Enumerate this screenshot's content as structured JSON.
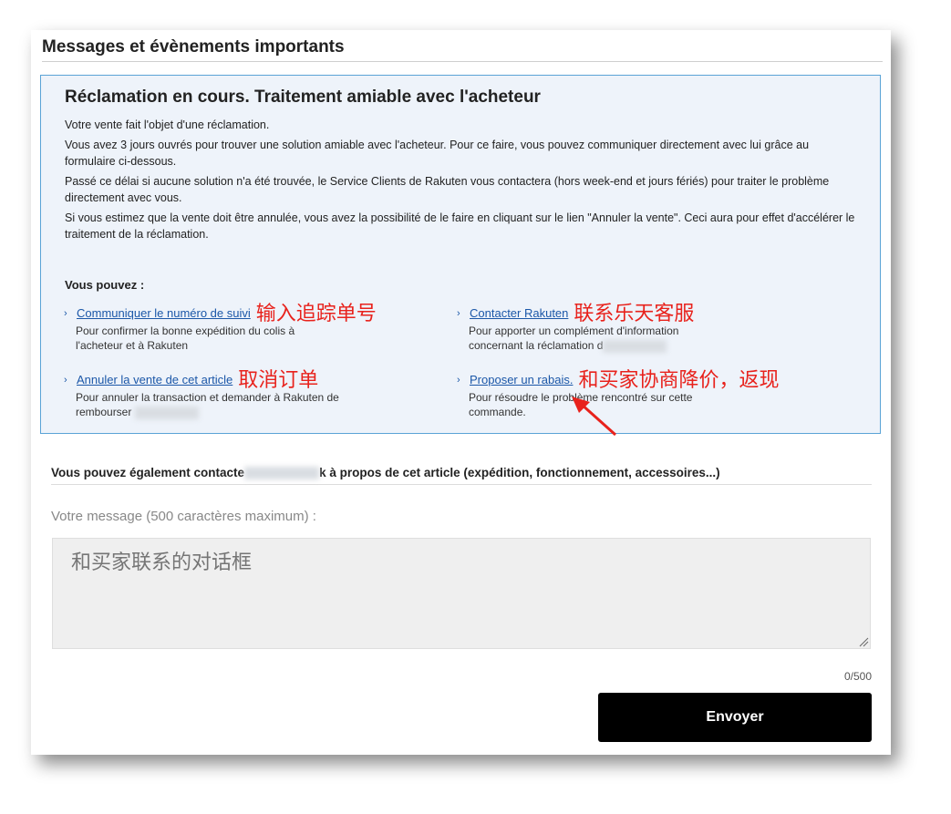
{
  "header": {
    "title": "Messages et évènements importants"
  },
  "claim": {
    "title": "Réclamation en cours. Traitement amiable avec l'acheteur",
    "paragraphs": [
      "Votre vente fait l'objet d'une réclamation.",
      "Vous avez 3 jours ouvrés pour trouver une solution amiable avec l'acheteur. Pour ce faire, vous pouvez communiquer directement avec lui grâce au formulaire ci-dessous.",
      "Passé ce délai si aucune solution n'a été trouvée, le Service Clients de Rakuten vous contactera (hors week-end et jours fériés) pour traiter le problème directement avec vous.",
      "Si vous estimez que la vente doit être annulée, vous avez la possibilité de le faire en cliquant sur le lien \"Annuler la vente\". Ceci aura pour effet d'accélérer le traitement de la réclamation."
    ],
    "vous_pouvez": "Vous pouvez :",
    "actions": {
      "tracking": {
        "link": "Communiquer le numéro de suivi",
        "annotation": "输入追踪单号",
        "desc1": "Pour confirmer la bonne expédition du colis à",
        "desc2": "l'acheteur et à Rakuten"
      },
      "contact": {
        "link": "Contacter Rakuten",
        "annotation": "联系乐天客服",
        "desc1": "Pour apporter un complément d'information",
        "desc2": "concernant la réclamation d"
      },
      "cancel": {
        "link": "Annuler la vente de cet article",
        "annotation": "取消订单",
        "desc1": "Pour annuler la transaction et demander à Rakuten de",
        "desc2": "rembourser"
      },
      "discount": {
        "link": "Proposer un rabais.",
        "annotation": "和买家协商降价，返现",
        "desc1": "Pour résoudre le problème rencontré sur cette",
        "desc2": "commande."
      }
    }
  },
  "contact": {
    "line_start": "Vous pouvez également contacte",
    "line_end": "k à propos de cet article (expédition, fonctionnement, accessoires...)"
  },
  "message": {
    "label": "Votre message (500 caractères maximum) :",
    "annotation": "和买家联系的对话框",
    "counter": "0/500"
  },
  "send": {
    "label": "Envoyer"
  },
  "colors": {
    "link": "#1b57a8",
    "annotation": "#e8221c",
    "claim_border": "#5aa3d6",
    "claim_bg": "#eef3fa"
  }
}
